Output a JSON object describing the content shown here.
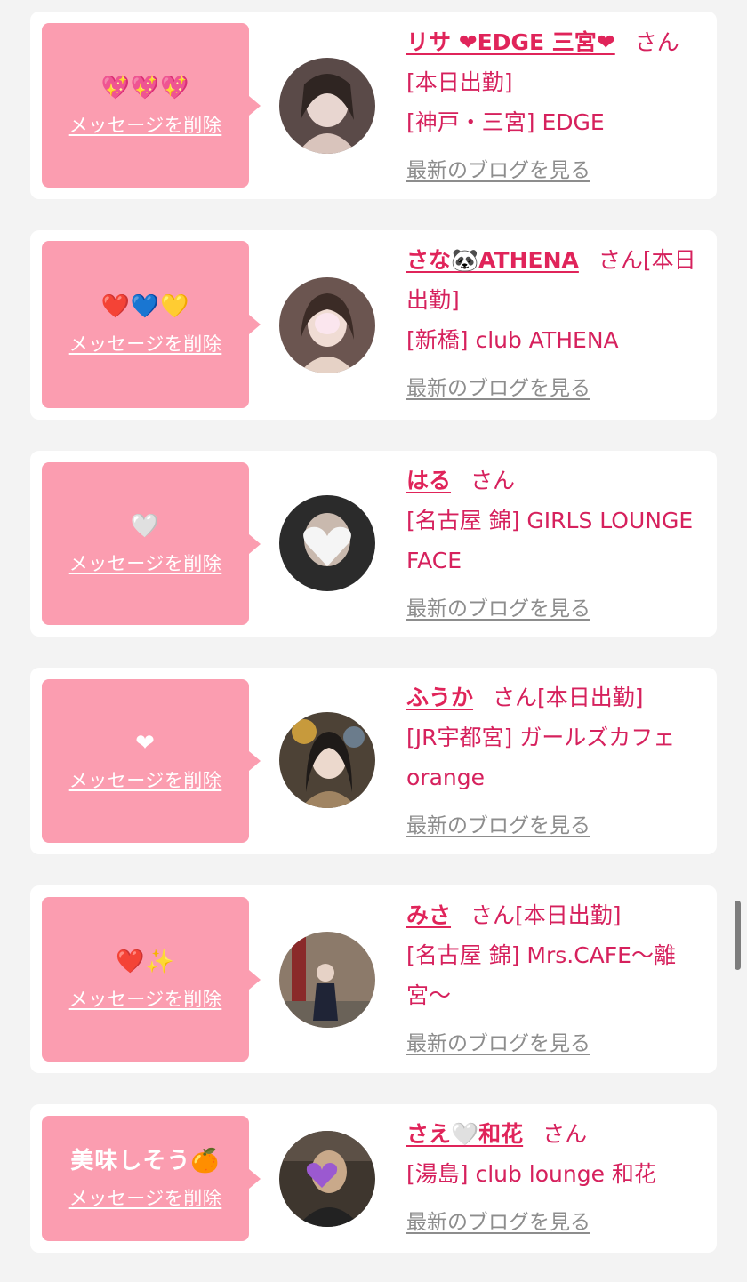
{
  "colors": {
    "page_bg": "#f3f3f3",
    "card_bg": "#ffffff",
    "bubble_bg": "#fb9db0",
    "name_color": "#e0245a",
    "link_gray": "#8d8d8d"
  },
  "entries": [
    {
      "message": "💖💖💖",
      "delete_label": "メッセージを削除",
      "name": "リサ ❤EDGE 三宮❤",
      "suffix": "さん",
      "status": "[本日出勤]",
      "store": "[神戸・三宮] EDGE",
      "blog_label": "最新のブログを見る",
      "avatar_tone": "#5a4a48"
    },
    {
      "message": "❤️💙💛",
      "delete_label": "メッセージを削除",
      "name": "さな🐼ATHENA",
      "suffix": "さん",
      "status": "[本日出勤]",
      "store": "[新橋] club ATHENA",
      "blog_label": "最新のブログを見る",
      "avatar_tone": "#6b5550"
    },
    {
      "message": "🤍",
      "delete_label": "メッセージを削除",
      "name": "はる",
      "suffix": "さん",
      "status": "",
      "store": "[名古屋 錦] GIRLS LOUNGE FACE",
      "blog_label": "最新のブログを見る",
      "avatar_tone": "#2b2b2b"
    },
    {
      "message": "❤",
      "delete_label": "メッセージを削除",
      "name": "ふうか",
      "suffix": "さん",
      "status": "[本日出勤]",
      "store": "[JR宇都宮] ガールズカフェ orange",
      "blog_label": "最新のブログを見る",
      "avatar_tone": "#4d4236"
    },
    {
      "message": "❤️✨",
      "delete_label": "メッセージを削除",
      "name": "みさ",
      "suffix": "さん",
      "status": "[本日出勤]",
      "store": "[名古屋 錦] Mrs.CAFE〜離宮〜",
      "blog_label": "最新のブログを見る",
      "avatar_tone": "#8c7a6a"
    },
    {
      "message": "美味しそう🍊",
      "delete_label": "メッセージを削除",
      "name": "さえ🤍和花",
      "suffix": "さん",
      "status": "",
      "store": "[湯島] club lounge 和花",
      "blog_label": "最新のブログを見る",
      "avatar_tone": "#3e362e"
    }
  ]
}
